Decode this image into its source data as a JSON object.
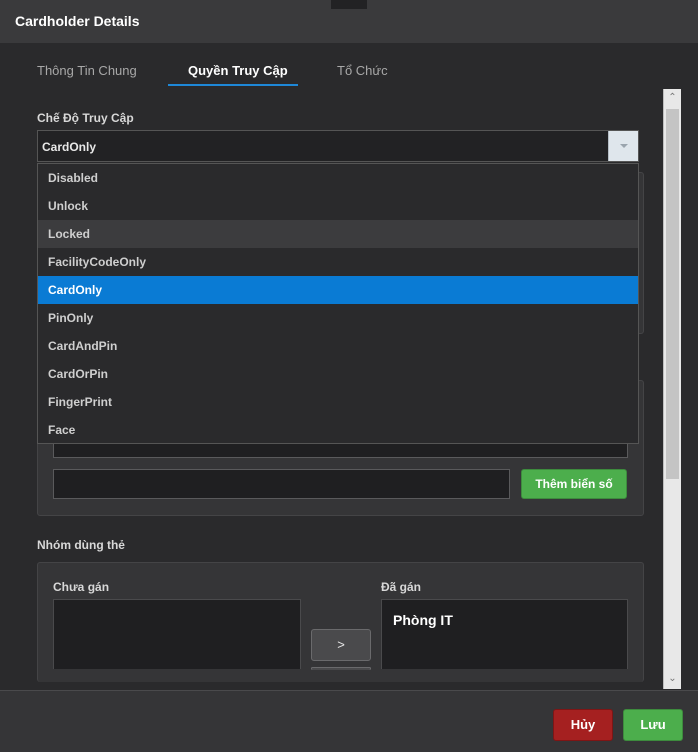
{
  "dialog": {
    "title": "Cardholder Details"
  },
  "tabs": [
    {
      "label": "Thông Tin Chung",
      "active": false
    },
    {
      "label": "Quyền Truy Cập",
      "active": true
    },
    {
      "label": "Tổ Chức",
      "active": false
    }
  ],
  "access_mode": {
    "label": "Chế Độ Truy Cập",
    "selected": "CardOnly",
    "options": [
      "Disabled",
      "Unlock",
      "Locked",
      "FacilityCodeOnly",
      "CardOnly",
      "PinOnly",
      "CardAndPin",
      "CardOrPin",
      "FingerPrint",
      "Face"
    ],
    "hovered": "Locked"
  },
  "plates": {
    "add_button": "Thêm biển số",
    "input_value": ""
  },
  "card_group": {
    "label": "Nhóm dùng thẻ",
    "unassigned_label": "Chưa gán",
    "assigned_label": "Đã gán",
    "assigned_items": [
      "Phòng IT"
    ],
    "move_right_label": ">"
  },
  "footer": {
    "cancel_label": "Hủy",
    "save_label": "Lưu"
  },
  "colors": {
    "accent": "#0a7bd4",
    "success": "#4cae4c",
    "danger": "#a52020",
    "background": "#2a2a2c"
  },
  "icons": {
    "dropdown": "chevron-down-icon",
    "scroll_up": "chevron-up-icon",
    "scroll_down": "chevron-down-icon"
  }
}
